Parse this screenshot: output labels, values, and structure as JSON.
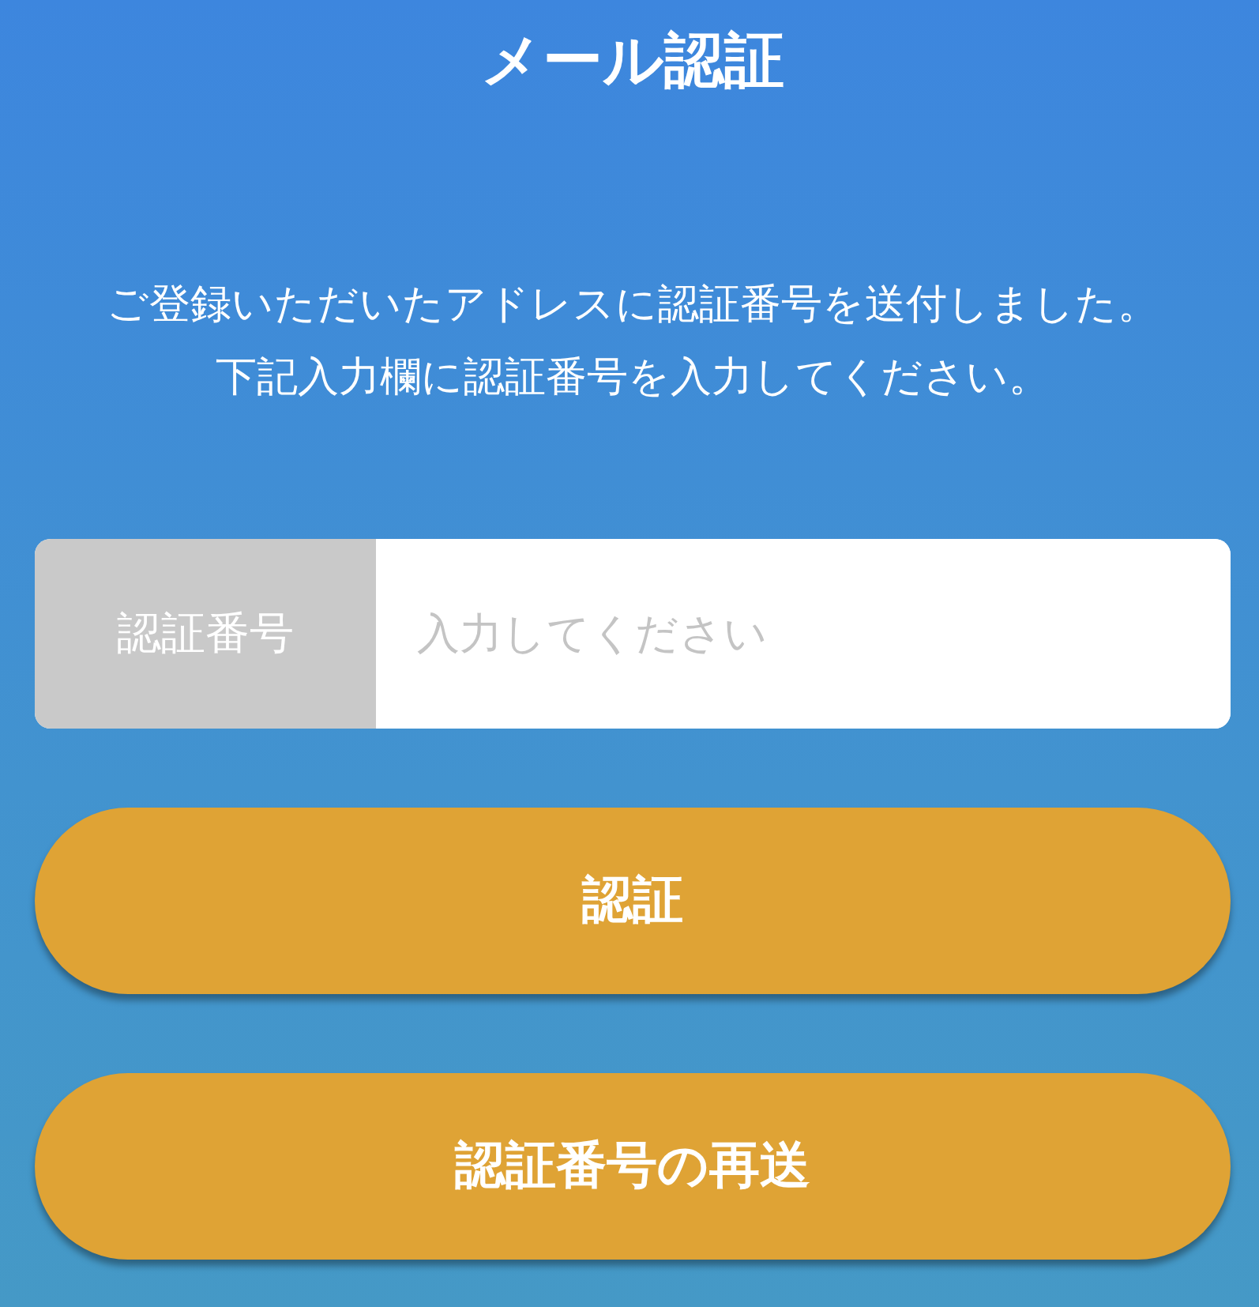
{
  "title": "メール認証",
  "message": [
    "ご登録いただいたアドレスに認証番号を送付しました。",
    "下記入力欄に認証番号を入力してください。"
  ],
  "code_field": {
    "label": "認証番号",
    "placeholder": "入力してください"
  },
  "buttons": [
    {
      "label": "認証"
    },
    {
      "label": "認証番号の再送"
    }
  ]
}
